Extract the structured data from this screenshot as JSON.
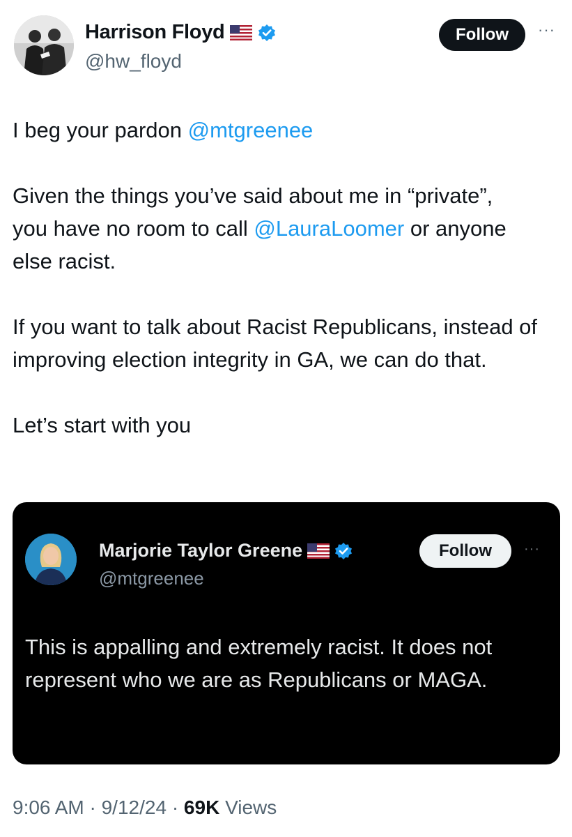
{
  "tweet": {
    "author": {
      "display_name": "Harrison Floyd",
      "handle": "@hw_floyd",
      "flag_icon": "us-flag-icon",
      "verified_icon": "verified-badge-icon"
    },
    "follow_label": "Follow",
    "more_icon": "more-options-icon",
    "text": {
      "p1_prefix": "I beg your pardon ",
      "p1_mention": "@mtgreenee",
      "p2_line1": "Given the things you’ve said about me in “private”,",
      "p2_before_mention": "you have no room to call ",
      "p2_mention": "@LauraLoomer",
      "p2_after_mention": " or anyone",
      "p2_line3": "else racist.",
      "p3": "If you want to talk about Racist Republicans, instead of improving election integrity in GA, we can do that.",
      "p4": "Let’s start with you"
    },
    "timestamp": "9:06 AM · 9/12/24 · ",
    "views_count": "69K",
    "views_label": " Views"
  },
  "quoted": {
    "author": {
      "display_name": "Marjorie Taylor Greene",
      "handle": "@mtgreenee"
    },
    "follow_label": "Follow",
    "text": "This is appalling and extremely racist.  It does not represent who we are as Republicans or MAGA."
  },
  "colors": {
    "link": "#1d9bf0",
    "text": "#0f1419",
    "secondary": "#536471",
    "quote_bg": "#000000"
  }
}
